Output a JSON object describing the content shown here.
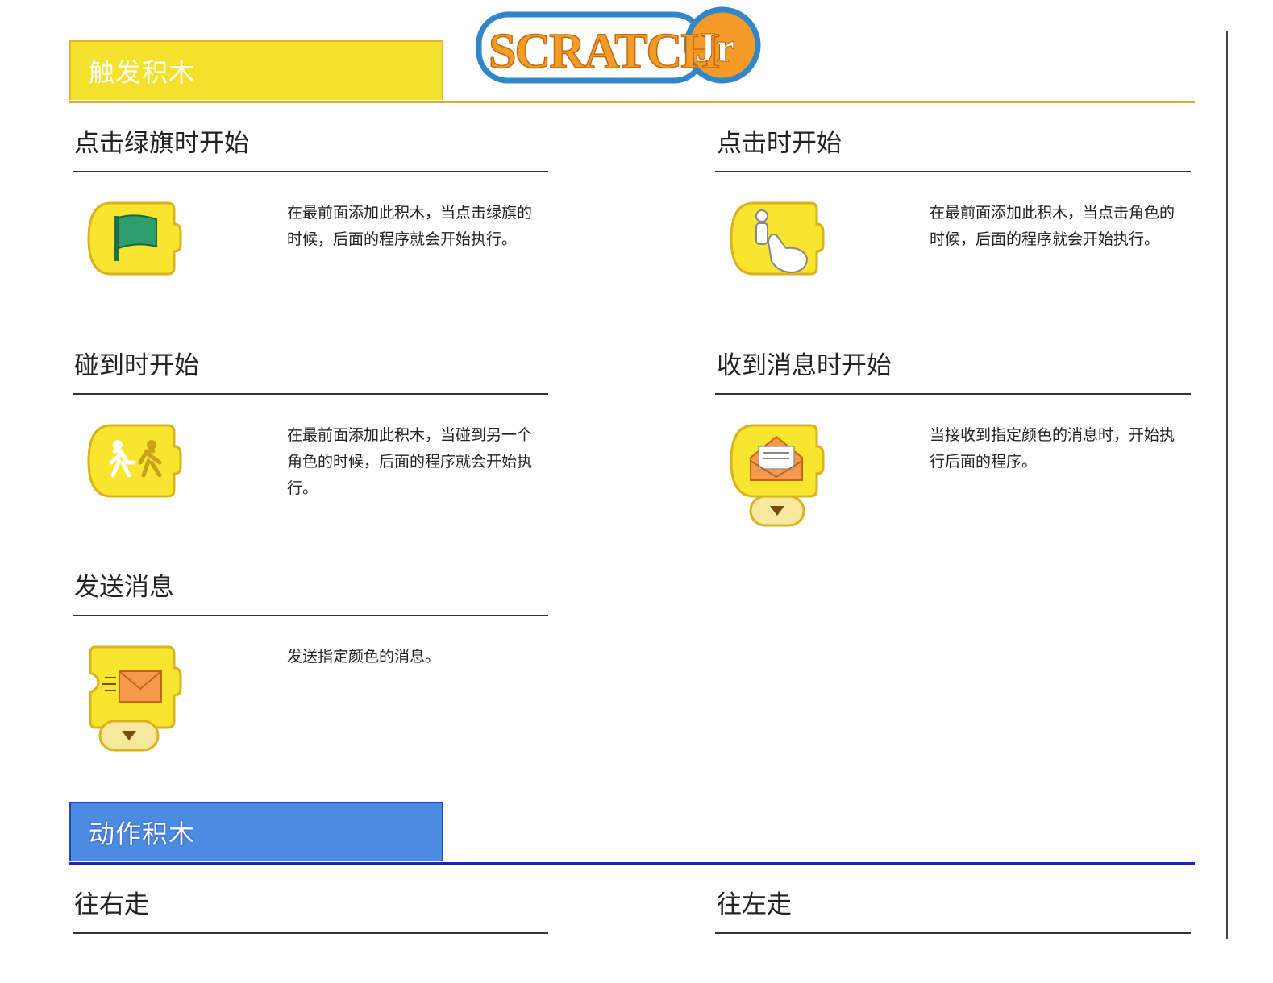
{
  "logo": {
    "text": "ScratchJr"
  },
  "sections": {
    "trigger": {
      "label": "触发积木",
      "color": "#f5e12c"
    },
    "motion": {
      "label": "动作积木",
      "color": "#4b8be0"
    }
  },
  "blocks": {
    "green_flag": {
      "title": "点击绿旗时开始",
      "desc": "在最前面添加此积木，当点击绿旗的时候，后面的程序就会开始执行。",
      "icon": "green-flag-icon"
    },
    "on_tap": {
      "title": "点击时开始",
      "desc": "在最前面添加此积木，当点击角色的时候，后面的程序就会开始执行。",
      "icon": "tap-hand-icon"
    },
    "on_bump": {
      "title": "碰到时开始",
      "desc": "在最前面添加此积木，当碰到另一个角色的时候，后面的程序就会开始执行。",
      "icon": "bump-runners-icon"
    },
    "on_message": {
      "title": "收到消息时开始",
      "desc": "当接收到指定颜色的消息时，开始执行后面的程序。",
      "icon": "open-envelope-icon"
    },
    "send_message": {
      "title": "发送消息",
      "desc": "发送指定颜色的消息。",
      "icon": "send-envelope-icon"
    },
    "move_right": {
      "title": "往右走"
    },
    "move_left": {
      "title": "往左走"
    }
  }
}
